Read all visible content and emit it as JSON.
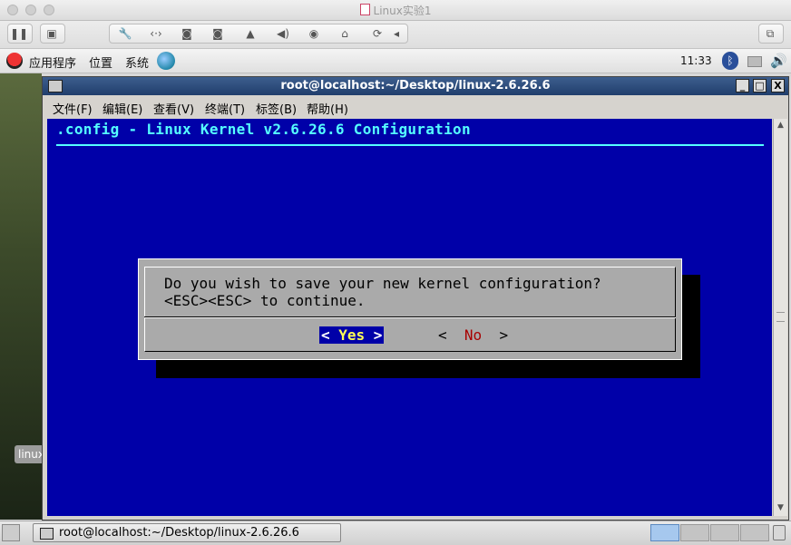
{
  "host": {
    "window_title": "Linux实验1",
    "toolbar_icons": [
      "pause-icon",
      "snapshot-icon",
      "wrench-icon",
      "network-icon",
      "harddisk-icon",
      "harddisk2-icon",
      "printer-icon",
      "sound-icon",
      "camera-icon",
      "usb-icon",
      "sync-icon",
      "collapse-icon",
      "fullscreen-icon"
    ]
  },
  "gnome_panel": {
    "menus": [
      "应用程序",
      "位置",
      "系统"
    ],
    "clock": "11:33"
  },
  "desktop": {
    "icon_label": "linux"
  },
  "terminal": {
    "title": "root@localhost:~/Desktop/linux-2.6.26.6",
    "menus": [
      "文件(F)",
      "编辑(E)",
      "查看(V)",
      "终端(T)",
      "标签(B)",
      "帮助(H)"
    ],
    "window_buttons": [
      "_",
      "□",
      "X"
    ]
  },
  "screen": {
    "header": ".config - Linux Kernel v2.6.26.6 Configuration",
    "colors": {
      "background": "#0000a8",
      "header": "#55ffff",
      "dialog": "#aaaaaa"
    }
  },
  "dialog": {
    "line1": "Do you wish to save your new kernel configuration?",
    "line2": "<ESC><ESC> to continue.",
    "yes": {
      "left": "< ",
      "hot": "Yes",
      "right": " >"
    },
    "no": {
      "left": "<  ",
      "hot": "No",
      "right": "  >"
    }
  },
  "taskbar": {
    "task_label": "root@localhost:~/Desktop/linux-2.6.26.6",
    "workspaces": 4,
    "active_workspace": 1
  }
}
